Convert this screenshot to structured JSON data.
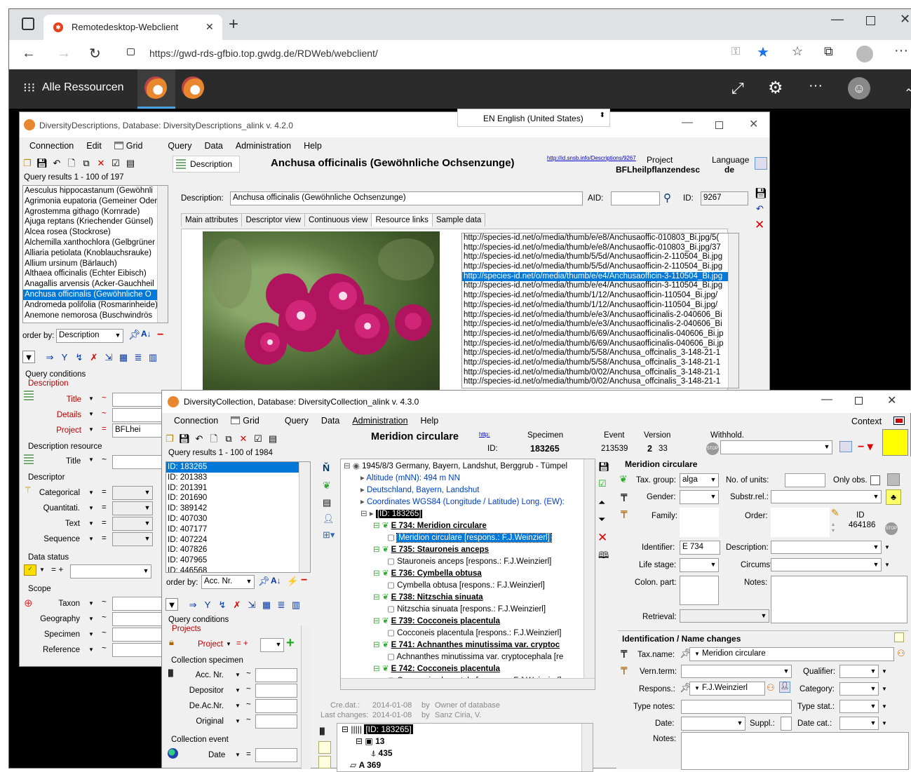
{
  "browser": {
    "tab_title": "Remotedesktop-Webclient",
    "url": "https://gwd-rds-gfbio.top.gwdg.de/RDWeb/webclient/"
  },
  "rd": {
    "title": "Alle Ressourcen"
  },
  "lang_popup": "EN English (United States)",
  "dd": {
    "title": "DiversityDescriptions,  Database: DiversityDescriptions_alink   v. 4.2.0",
    "menu": [
      "Connection",
      "Edit",
      "Grid",
      "Query",
      "Data",
      "Administration",
      "Help"
    ],
    "desc_tab": "Description",
    "heading": "Anchusa officinalis (Gewöhnliche Ochsenzunge)",
    "link": "http://id.snsb.info/Descriptions/9267",
    "project_label": "Project",
    "project_value": "BFLheilpflanzendesc",
    "language_label": "Language",
    "language_value": "de",
    "query_results": "Query results   1 - 100 of 197",
    "results": [
      "Aesculus hippocastanum (Gewöhnli",
      "Agrimonia eupatoria (Gemeiner Oder",
      "Agrostemma githago (Kornrade)",
      "Ajuga reptans (Kriechender Günsel)",
      "Alcea rosea (Stockrose)",
      "Alchemilla xanthochlora (Gelbgrüner",
      "Alliaria petiolata (Knoblauchsrauke)",
      "Allium ursinum (Bärlauch)",
      "Althaea officinalis (Echter Eibisch)",
      "Anagallis arvensis (Acker-Gauchheil",
      "Anchusa officinalis (Gewöhnliche O",
      "Andromeda polifolia (Rosmarinheide)",
      "Anemone nemorosa (Buschwindrös"
    ],
    "selected_index": 10,
    "order_by_label": "order by:",
    "order_by_value": "Description",
    "qc_title": "Query conditions",
    "qc_desc": "Description",
    "qc_rows": [
      {
        "label": "Title",
        "op": "~",
        "val": ""
      },
      {
        "label": "Details",
        "op": "~",
        "val": ""
      },
      {
        "label": "Project",
        "op": "=",
        "val": "BFLhei"
      }
    ],
    "desc_resource": "Description resource",
    "dr_title": "Title",
    "descriptor": "Descriptor",
    "descriptor_rows": [
      {
        "label": "Categorical",
        "op": "="
      },
      {
        "label": "Quantitati.",
        "op": "="
      },
      {
        "label": "Text",
        "op": "="
      },
      {
        "label": "Sequence",
        "op": "="
      }
    ],
    "data_status": "Data status",
    "scope": "Scope",
    "scope_rows": [
      {
        "label": "Taxon",
        "op": "~"
      },
      {
        "label": "Geography",
        "op": "~"
      },
      {
        "label": "Specimen",
        "op": "~"
      },
      {
        "label": "Reference",
        "op": "~"
      }
    ],
    "description_label": "Description:",
    "description_value": "Anchusa officinalis (Gewöhnliche Ochsenzunge)",
    "aid_label": "AID:",
    "id_label": "ID:",
    "id_value": "9267",
    "tabs": [
      "Main attributes",
      "Descriptor view",
      "Continuous view",
      "Resource links",
      "Sample data"
    ],
    "active_tab": 3,
    "urls": [
      "http://species-id.net/o/media/thumb/e/e8/Anchusaoffic-010803_Bi.jpg/5(",
      "http://species-id.net/o/media/thumb/e/e8/Anchusaoffic-010803_Bi.jpg/37",
      "http://species-id.net/o/media/thumb/5/5d/Anchusaofficin-2-110504_Bi.jpg",
      "http://species-id.net/o/media/thumb/5/5d/Anchusaofficin-2-110504_Bi.jpg",
      "http://species-id.net/o/media/thumb/e/e4/Anchusaofficin-3-110504_Bi.jpg",
      "http://species-id.net/o/media/thumb/e/e4/Anchusaofficin-3-110504_Bi.jpg",
      "http://species-id.net/o/media/thumb/1/12/Anchusaofficin-110504_Bi.jpg/",
      "http://species-id.net/o/media/thumb/1/12/Anchusaofficin-110504_Bi.jpg/",
      "http://species-id.net/o/media/thumb/e/e3/Anchusaofficinalis-2-040606_Bi",
      "http://species-id.net/o/media/thumb/e/e3/Anchusaofficinalis-2-040606_Bi",
      "http://species-id.net/o/media/thumb/6/69/Anchusaofficinalis-040606_Bi.jp",
      "http://species-id.net/o/media/thumb/6/69/Anchusaofficinalis-040606_Bi.jp",
      "http://species-id.net/o/media/thumb/5/58/Anchusa_offcinalis_3-148-21-1",
      "http://species-id.net/o/media/thumb/5/58/Anchusa_offcinalis_3-148-21-1",
      "http://species-id.net/o/media/thumb/0/02/Anchusa_offcinalis_3-148-21-1",
      "http://species-id.net/o/media/thumb/0/02/Anchusa_offcinalis_3-148-21-1"
    ],
    "url_selected": 4
  },
  "dc": {
    "title": "DiversityCollection,  Database: DiversityCollection_alink   v. 4.3.0",
    "menu": [
      "Connection",
      "Grid",
      "Query",
      "Data",
      "Administration",
      "Help"
    ],
    "context": "Context",
    "heading": "Meridion circulare",
    "link": "http:",
    "id_label": "ID:",
    "specimen_label": "Specimen",
    "specimen_value": "183265",
    "event_label": "Event",
    "event_value": "213539",
    "version_label": "Version",
    "version_value": "2",
    "version_value2": "33",
    "withhold_label": "Withhold.",
    "query_results": "Query results   1 - 100 of 1984",
    "results": [
      "ID: 183265",
      "ID: 201383",
      "ID: 201391",
      "ID: 201690",
      "ID: 389142",
      "ID: 407030",
      "ID: 407177",
      "ID: 407224",
      "ID: 407826",
      "ID: 407965",
      "ID: 446568"
    ],
    "order_by_label": "order by:",
    "order_by_value": "Acc. Nr.",
    "qc_title": "Query conditions",
    "qc_projects": "Projects",
    "qc_project": "Project",
    "coll_specimen": "Collection specimen",
    "cs_rows": [
      {
        "label": "Acc. Nr.",
        "op": "~"
      },
      {
        "label": "Depositor",
        "op": "~"
      },
      {
        "label": "De.Ac.Nr.",
        "op": "~"
      },
      {
        "label": "Original",
        "op": "~"
      }
    ],
    "coll_event": "Collection event",
    "ce_date": "Date",
    "tree": [
      {
        "indent": 0,
        "text": "1945/8/3 Germany, Bayern, Landshut, Berggrub - Tümpel"
      },
      {
        "indent": 1,
        "text": "Altitude (mNN): 494 m NN"
      },
      {
        "indent": 1,
        "text": "Deutschland, Bayern, Landshut"
      },
      {
        "indent": 1,
        "text": "Coordinates WGS84 (Longitude / Latitude) Long. (EW):"
      },
      {
        "indent": 1,
        "text": "[ID: 183265]"
      },
      {
        "indent": 2,
        "text": "E 734: Meridion circulare"
      },
      {
        "indent": 3,
        "text": "Meridion circulare   [respons.: F.J.Weinzierl]"
      },
      {
        "indent": 2,
        "text": "E 735: Stauroneis anceps"
      },
      {
        "indent": 3,
        "text": "Stauroneis anceps   [respons.: F.J.Weinzierl]"
      },
      {
        "indent": 2,
        "text": "E 736: Cymbella obtusa"
      },
      {
        "indent": 3,
        "text": "Cymbella obtusa   [respons.: F.J.Weinzierl]"
      },
      {
        "indent": 2,
        "text": "E 738: Nitzschia sinuata"
      },
      {
        "indent": 3,
        "text": "Nitzschia sinuata   [respons.: F.J.Weinzierl]"
      },
      {
        "indent": 2,
        "text": "E 739: Cocconeis placentula"
      },
      {
        "indent": 3,
        "text": "Cocconeis placentula   [respons.: F.J.Weinzierl]"
      },
      {
        "indent": 2,
        "text": "E 741: Achnanthes minutissima var. cryptoc"
      },
      {
        "indent": 3,
        "text": "Achnanthes minutissima var. cryptocephala   [re"
      },
      {
        "indent": 2,
        "text": "E 742: Cocconeis placentula"
      },
      {
        "indent": 3,
        "text": "Cocconeis placentula   [respons.: F.J.Weinzierl]"
      }
    ],
    "cre_label": "Cre.dat.:",
    "cre_date": "2014-01-08",
    "by": "by",
    "cre_by": "Owner of database",
    "last_label": "Last changes:",
    "last_date": "2014-01-08",
    "last_by": "Sanz Ciria, V.",
    "tree2": [
      {
        "text": "[ID: 183265]"
      },
      {
        "text": "13"
      },
      {
        "text": "435"
      },
      {
        "text": "A 369"
      }
    ],
    "right": {
      "title": "Meridion circulare",
      "taxgroup_label": "Tax. group:",
      "taxgroup_value": "alga",
      "units_label": "No. of units:",
      "onlyobs_label": "Only obs.",
      "gender_label": "Gender:",
      "substr_label": "Substr.rel.:",
      "family_label": "Family:",
      "order_label": "Order:",
      "id_label": "ID",
      "id_value": "464186",
      "identifier_label": "Identifier:",
      "identifier_value": "E 734",
      "description_label": "Description:",
      "lifestage_label": "Life stage:",
      "circumst_label": "Circumst.:",
      "colon_label": "Colon. part:",
      "notes_label": "Notes:",
      "retrieval_label": "Retrieval:",
      "ident_header": "Identification / Name changes",
      "taxname_label": "Tax.name:",
      "taxname_value": "Meridion circulare",
      "vernterm_label": "Vern.term:",
      "qualifier_label": "Qualifier:",
      "respons_label": "Respons.:",
      "respons_value": "F.J.Weinzierl",
      "category_label": "Category:",
      "typenotes_label": "Type notes:",
      "typestat_label": "Type stat.:",
      "date_label": "Date:",
      "suppl_label": "Suppl.:",
      "datecat_label": "Date cat.:",
      "notes2_label": "Notes:"
    }
  },
  "colors": {
    "selection": "#0078d7",
    "rd_bar": "#2b2b2b",
    "window_bg": "#f0f0f0",
    "link": "#0000cc",
    "label_red": "#b00000"
  }
}
